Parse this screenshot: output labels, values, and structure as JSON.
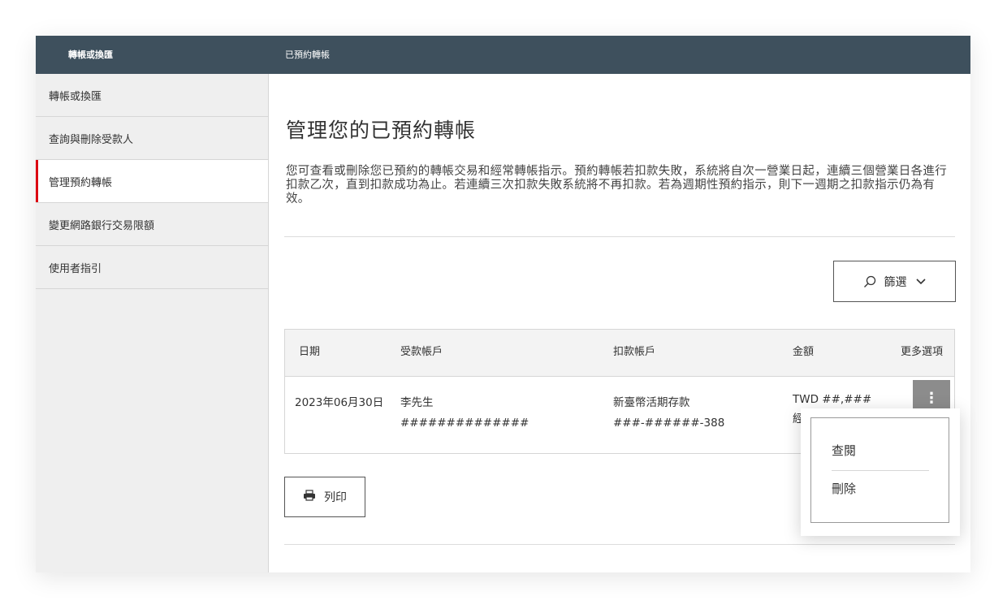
{
  "topbar": {
    "left_title": "轉帳或換匯",
    "right_title": "已預約轉帳"
  },
  "sidebar": {
    "items": [
      {
        "label": "轉帳或換匯"
      },
      {
        "label": "查詢與刪除受款人"
      },
      {
        "label": "管理預約轉帳"
      },
      {
        "label": "變更網路銀行交易限額"
      },
      {
        "label": "使用者指引"
      }
    ],
    "active_index": 2
  },
  "main": {
    "title": "管理您的已預約轉帳",
    "description": "您可查看或刪除您已預約的轉帳交易和經常轉帳指示。預約轉帳若扣款失敗，系統將自次一營業日起，連續三個營業日各進行扣款乙次，直到扣款成功為止。若連續三次扣款失敗系統將不再扣款。若為週期性預約指示，則下一週期之扣款指示仍為有效。",
    "filter_label": "篩選",
    "print_label": "列印"
  },
  "table": {
    "headers": {
      "date": "日期",
      "payee": "受款帳戶",
      "debit": "扣款帳戶",
      "amount": "金額",
      "more": "更多選項"
    },
    "rows": [
      {
        "date": "2023年06月30日",
        "payee_name": "李先生",
        "payee_account": "##############",
        "debit_name": "新臺幣活期存款",
        "debit_account": "###-######-388",
        "amount": "TWD ##,###",
        "amount_sub": "經",
        "more_label": "⋮"
      }
    ]
  },
  "popup_menu": {
    "items": [
      {
        "label": "查閱"
      },
      {
        "label": "刪除"
      }
    ]
  },
  "colors": {
    "topbar": "#3e505d",
    "accent": "#db0011",
    "sidebar_bg": "#efefef",
    "more_button": "#8c8c8c"
  }
}
